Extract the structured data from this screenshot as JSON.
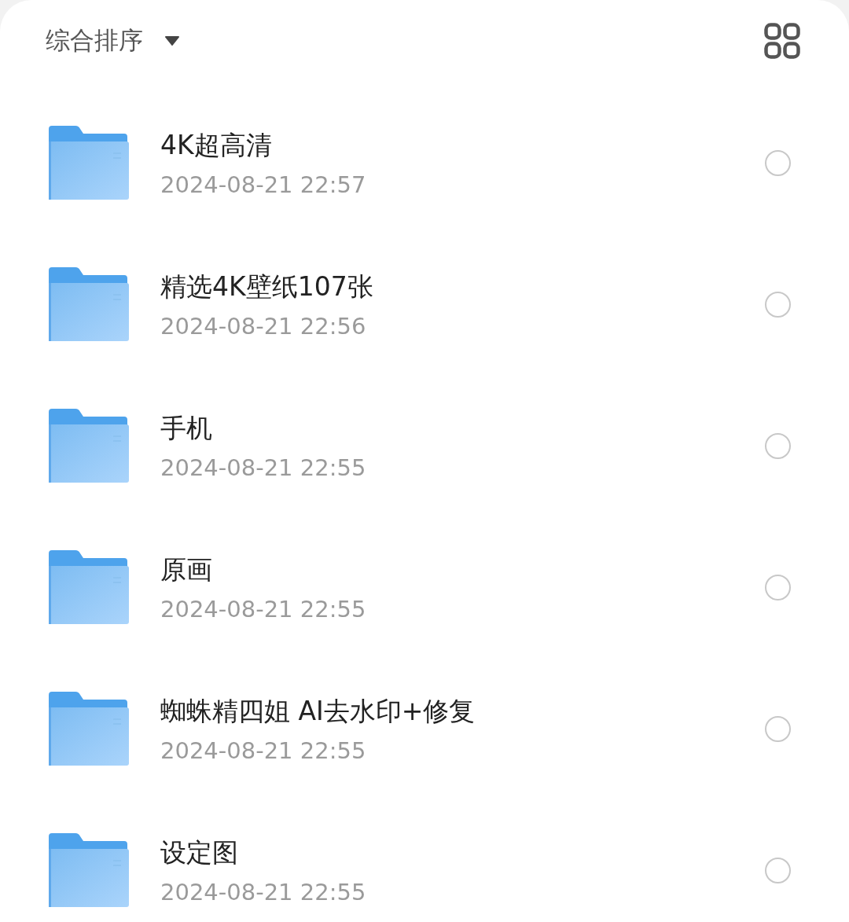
{
  "sort_menu": {
    "label": "综合排序"
  },
  "items": [
    {
      "name": "4K超高清",
      "date": "2024-08-21 22:57",
      "selected": false
    },
    {
      "name": "精选4K壁纸107张",
      "date": "2024-08-21 22:56",
      "selected": false
    },
    {
      "name": "手机",
      "date": "2024-08-21 22:55",
      "selected": false
    },
    {
      "name": "原画",
      "date": "2024-08-21 22:55",
      "selected": false
    },
    {
      "name": "蜘蛛精四姐 AI去水印+修复",
      "date": "2024-08-21 22:55",
      "selected": false
    },
    {
      "name": "设定图",
      "date": "2024-08-21 22:55",
      "selected": false
    }
  ]
}
